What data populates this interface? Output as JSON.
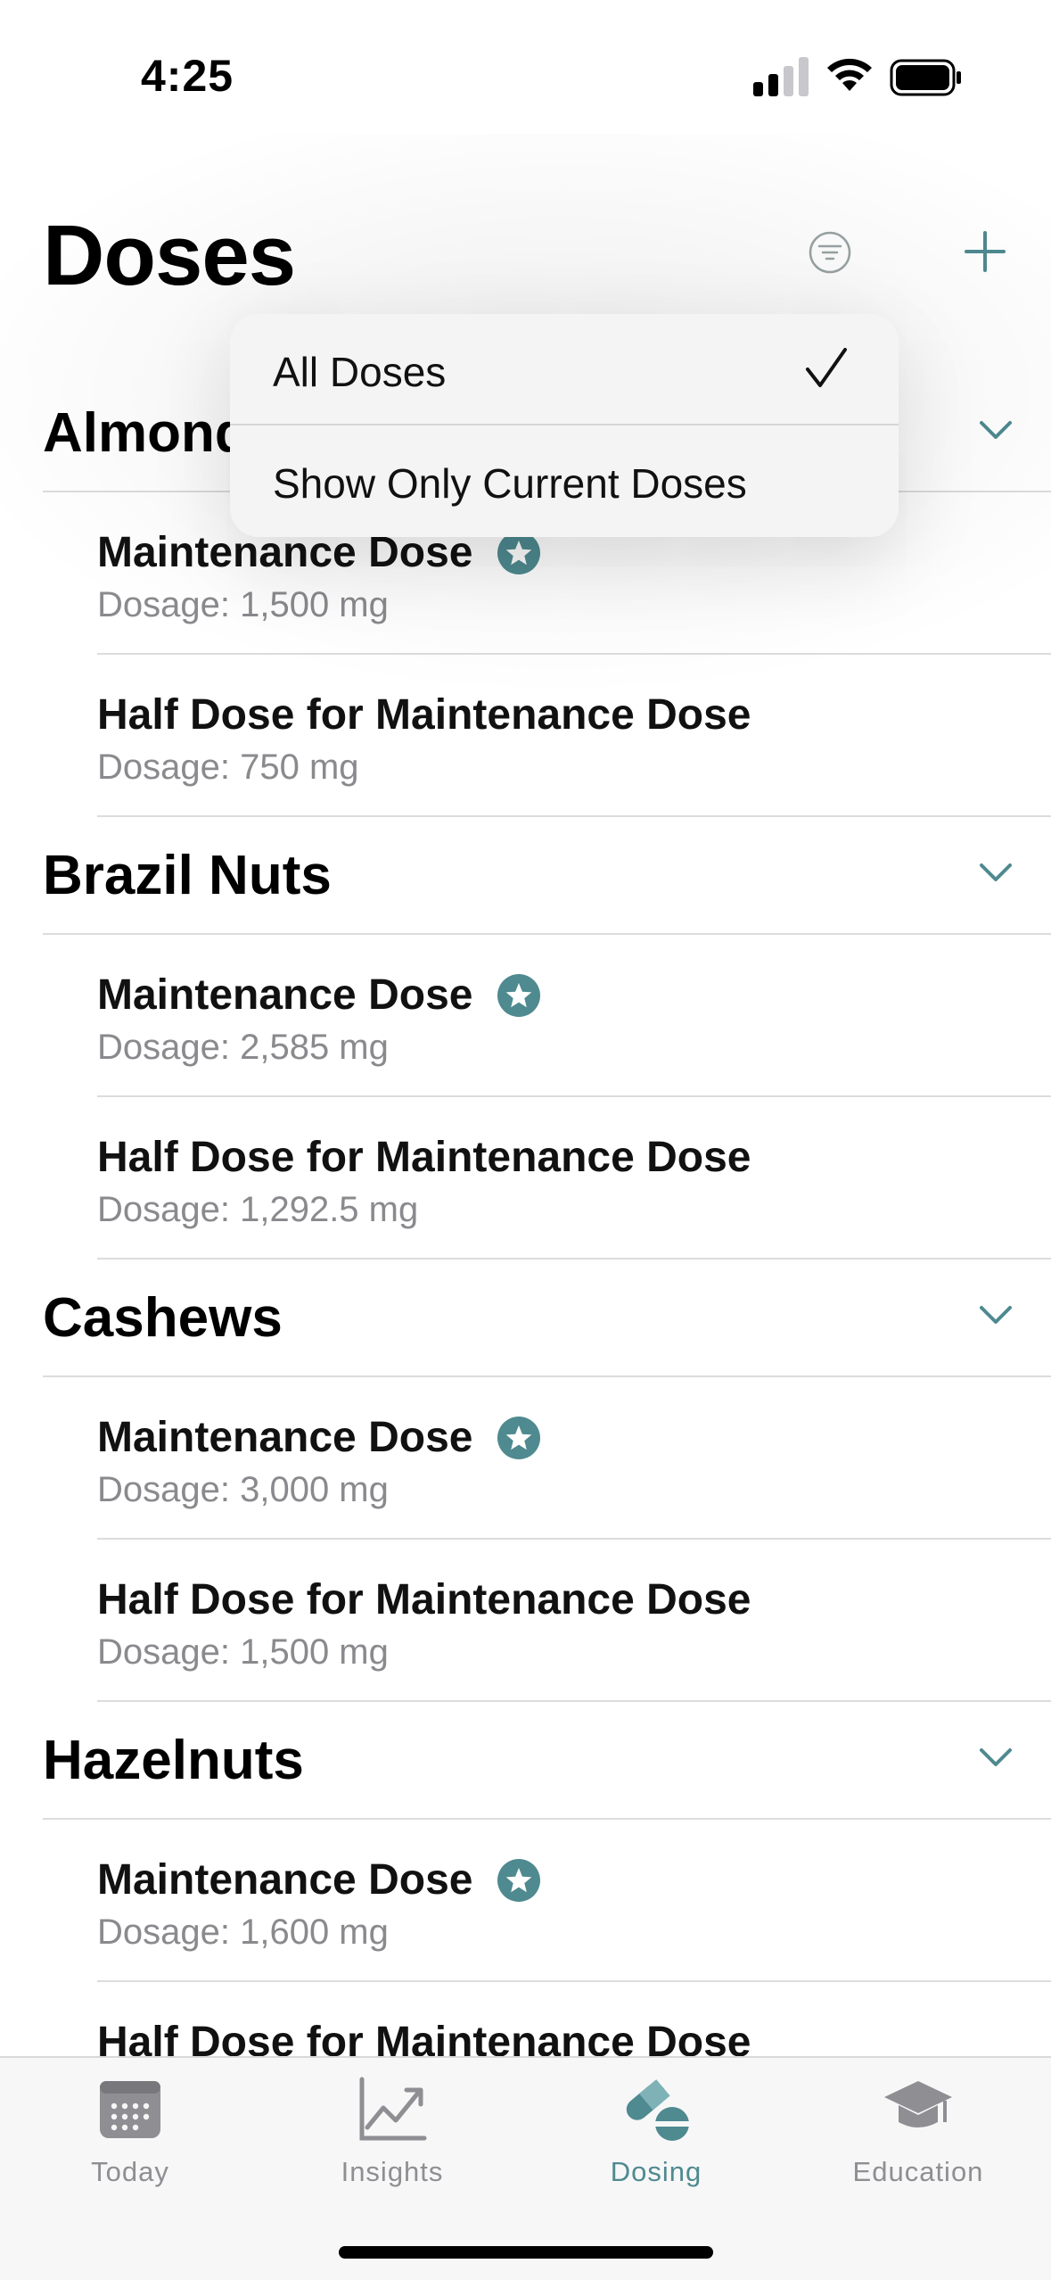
{
  "status_bar": {
    "time": "4:25"
  },
  "header": {
    "title": "Doses",
    "filter_icon": "filter-circle-icon",
    "add_icon": "plus-icon"
  },
  "accent_color": "#4e8a90",
  "dropdown": {
    "items": [
      {
        "label": "All Doses",
        "selected": true
      },
      {
        "label": "Show Only Current Doses",
        "selected": false
      }
    ]
  },
  "groups": [
    {
      "title": "Almonds",
      "doses": [
        {
          "name": "Maintenance Dose",
          "starred": true,
          "amount": "Dosage: 1,500 mg"
        },
        {
          "name": "Half Dose for Maintenance Dose",
          "starred": false,
          "amount": "Dosage: 750 mg"
        }
      ]
    },
    {
      "title": "Brazil Nuts",
      "doses": [
        {
          "name": "Maintenance Dose",
          "starred": true,
          "amount": "Dosage: 2,585 mg"
        },
        {
          "name": "Half Dose for Maintenance Dose",
          "starred": false,
          "amount": "Dosage: 1,292.5 mg"
        }
      ]
    },
    {
      "title": "Cashews",
      "doses": [
        {
          "name": "Maintenance Dose",
          "starred": true,
          "amount": "Dosage: 3,000 mg"
        },
        {
          "name": "Half Dose for Maintenance Dose",
          "starred": false,
          "amount": "Dosage: 1,500 mg"
        }
      ]
    },
    {
      "title": "Hazelnuts",
      "doses": [
        {
          "name": "Maintenance Dose",
          "starred": true,
          "amount": "Dosage: 1,600 mg"
        },
        {
          "name": "Half Dose for Maintenance Dose",
          "starred": false,
          "amount": ""
        }
      ]
    }
  ],
  "tab_bar": {
    "tabs": [
      {
        "label": "Today",
        "icon": "calendar-icon",
        "active": false
      },
      {
        "label": "Insights",
        "icon": "chart-line-icon",
        "active": false
      },
      {
        "label": "Dosing",
        "icon": "pills-icon",
        "active": true
      },
      {
        "label": "Education",
        "icon": "graduation-cap-icon",
        "active": false
      }
    ]
  }
}
